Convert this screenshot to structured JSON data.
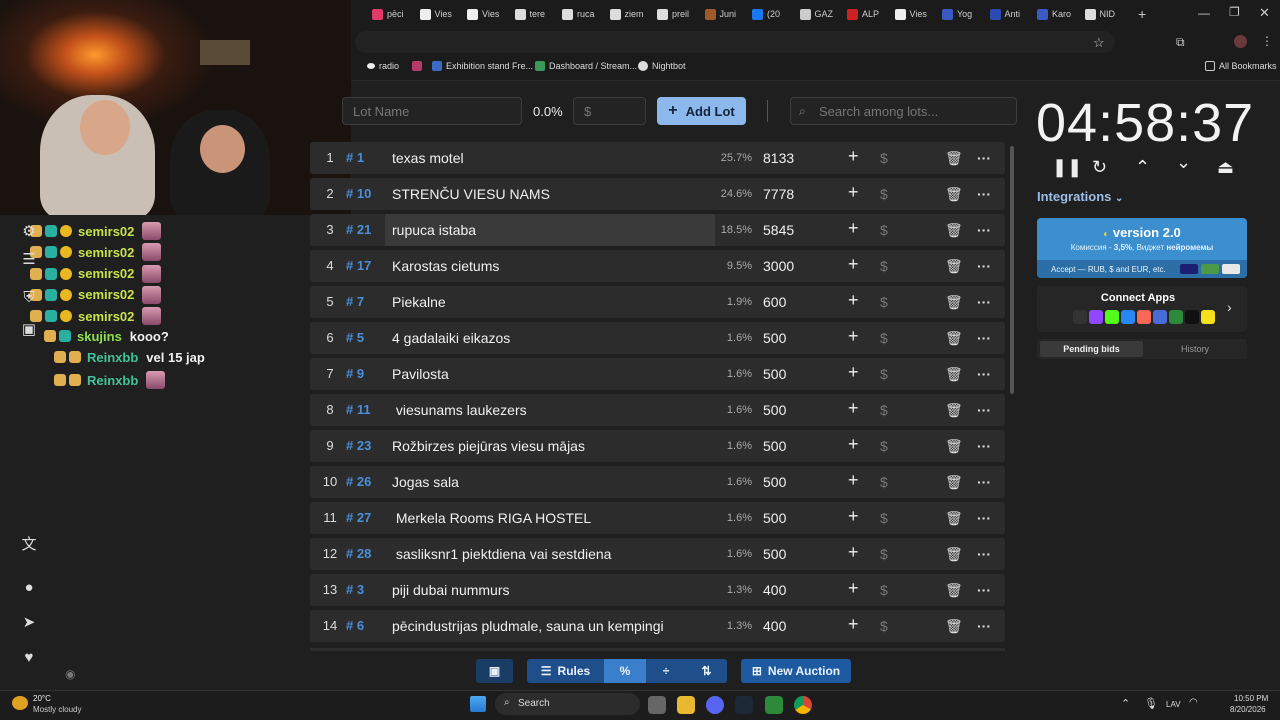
{
  "browser": {
    "tabs": [
      "pēci",
      "Vies",
      "Vies",
      "tere",
      "ruca",
      "ziem",
      "preil",
      "Juni",
      "(20",
      "GAZ",
      "ALP",
      "Vies",
      "Yog",
      "Anti",
      "Karo",
      "NID"
    ],
    "bookmarks": [
      "radio",
      "Exhibition stand Fre...",
      "Dashboard / Stream...",
      "Nightbot"
    ],
    "all_bookmarks": "All Bookmarks"
  },
  "chat": {
    "messages": [
      {
        "user": "semirs02",
        "text": "",
        "color": "#c6e34a"
      },
      {
        "user": "semirs02",
        "text": "",
        "color": "#c6e34a"
      },
      {
        "user": "semirs02",
        "text": "",
        "color": "#c6e34a"
      },
      {
        "user": "semirs02",
        "text": "",
        "color": "#c6e34a"
      },
      {
        "user": "semirs02",
        "text": "",
        "color": "#c6e34a"
      },
      {
        "user": "skujins",
        "text": "kooo?",
        "color": "#8ee04a"
      },
      {
        "user": "Reinxbb",
        "text": "vel 15 jap",
        "color": "#3fc49a"
      },
      {
        "user": "Reinxbb",
        "text": "",
        "color": "#3fc49a"
      }
    ]
  },
  "controls": {
    "lot_name_placeholder": "Lot Name",
    "percent": "0.0%",
    "amount_placeholder": "$",
    "add_lot": "Add Lot",
    "search_placeholder": "Search among lots..."
  },
  "lots": [
    {
      "idx": "1",
      "id": "# 1",
      "name": "texas motel",
      "pct": "25.7%",
      "amount": "8133"
    },
    {
      "idx": "2",
      "id": "# 10",
      "name": "STRENČU VIESU NAMS",
      "pct": "24.6%",
      "amount": "7778"
    },
    {
      "idx": "3",
      "id": "# 21",
      "name": "rupuca istaba",
      "pct": "18.5%",
      "amount": "5845"
    },
    {
      "idx": "4",
      "id": "# 17",
      "name": "Karostas cietums",
      "pct": "9.5%",
      "amount": "3000"
    },
    {
      "idx": "5",
      "id": "# 7",
      "name": "Piekalne",
      "pct": "1.9%",
      "amount": "600"
    },
    {
      "idx": "6",
      "id": "# 5",
      "name": "4 gadalaiki eikazos",
      "pct": "1.6%",
      "amount": "500"
    },
    {
      "idx": "7",
      "id": "# 9",
      "name": "Pavilosta",
      "pct": "1.6%",
      "amount": "500"
    },
    {
      "idx": "8",
      "id": "# 11",
      "name": " viesunams laukezers",
      "pct": "1.6%",
      "amount": "500"
    },
    {
      "idx": "9",
      "id": "# 23",
      "name": "Rožbirzes piejūras viesu mājas",
      "pct": "1.6%",
      "amount": "500"
    },
    {
      "idx": "10",
      "id": "# 26",
      "name": "Jogas sala",
      "pct": "1.6%",
      "amount": "500"
    },
    {
      "idx": "11",
      "id": "# 27",
      "name": " Merkela Rooms RIGA HOSTEL",
      "pct": "1.6%",
      "amount": "500"
    },
    {
      "idx": "12",
      "id": "# 28",
      "name": " sasliksnr1 piektdiena vai sestdiena",
      "pct": "1.6%",
      "amount": "500"
    },
    {
      "idx": "13",
      "id": "# 3",
      "name": "piji dubai nummurs",
      "pct": "1.3%",
      "amount": "400"
    },
    {
      "idx": "14",
      "id": "# 6",
      "name": "pēcindustrijas pludmale, sauna un kempingi",
      "pct": "1.3%",
      "amount": "400"
    }
  ],
  "panel": {
    "timer": "04:58:37",
    "integrations": "Integrations",
    "version": "version 2.0",
    "version_sub_prefix": "Комиссия - ",
    "version_commission": "3,5%",
    "version_sub_mid": ", Виджет ",
    "version_widget": "нейромемы",
    "version_accept": "Accept — RUB, $ and EUR, etc.",
    "connect_apps": "Connect Apps",
    "pending_bids": "Pending bids",
    "history": "History"
  },
  "toolbar": {
    "rules": "Rules",
    "new_auction": "New Auction"
  },
  "taskbar": {
    "temp": "20°C",
    "weather": "Mostly cloudy",
    "search": "Search",
    "lang": "LAV",
    "time": "10:50 PM",
    "date": "8/20/2026"
  },
  "colors": {
    "accent": "#4a90d9",
    "add_lot_bg": "#8db8ec",
    "version_bg": "#3b8fce",
    "toolbar_bg": "#1e4f8a"
  }
}
